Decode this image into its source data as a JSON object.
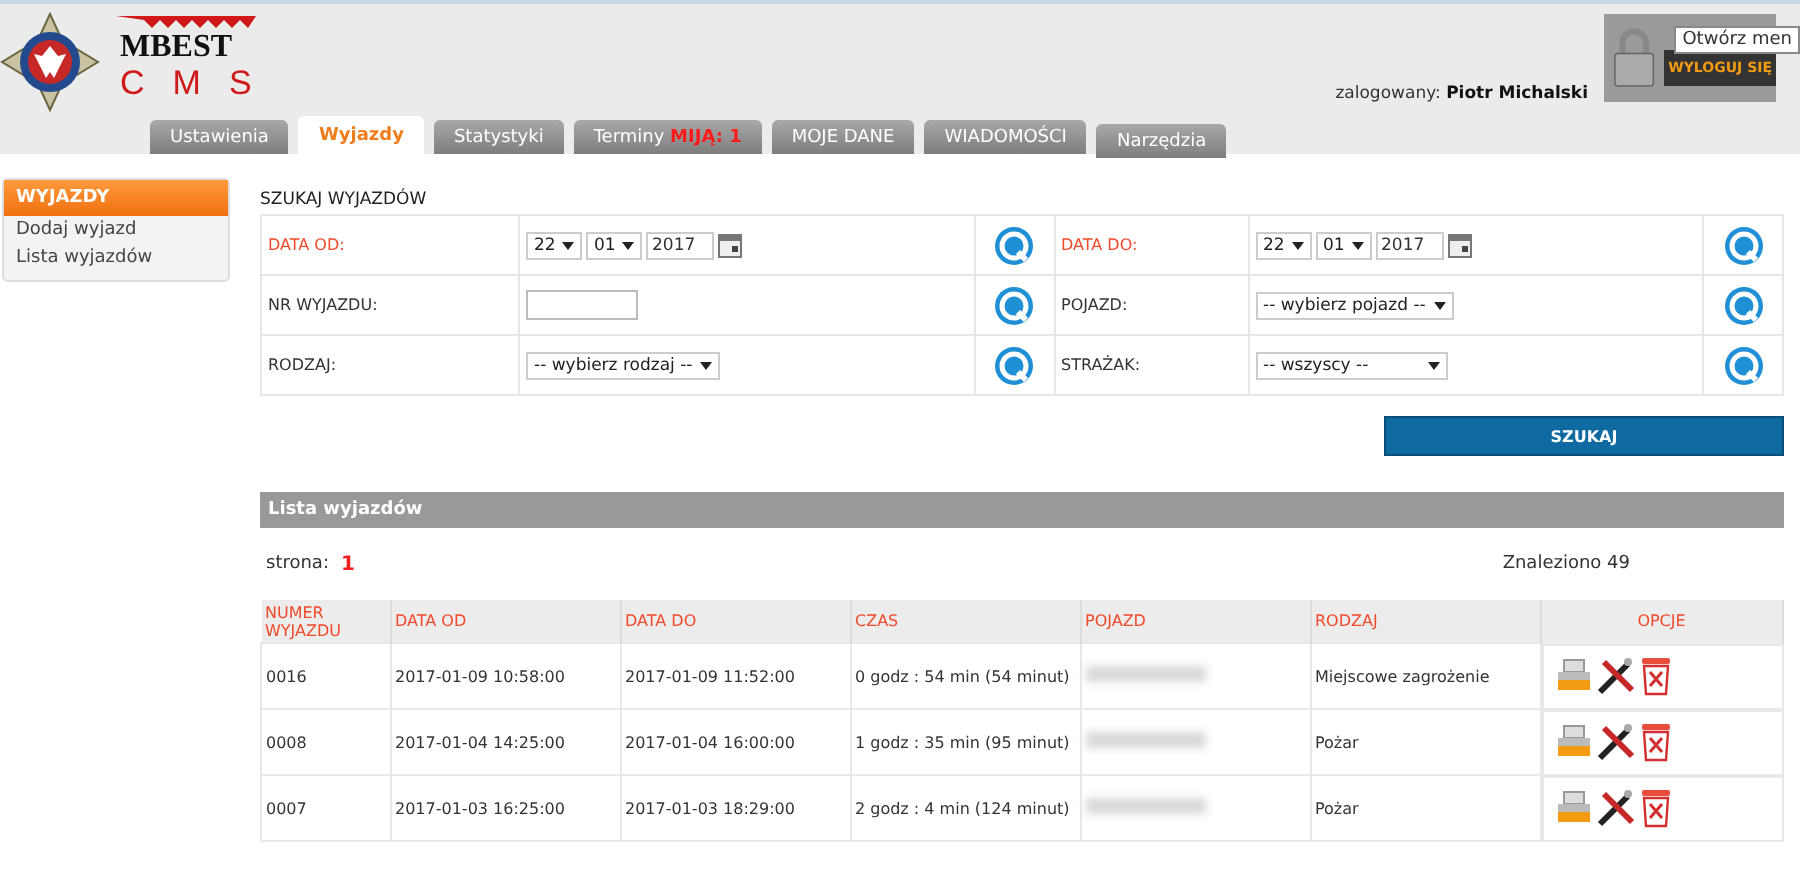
{
  "logo": {
    "top": "MBEST",
    "bottom": "CMS"
  },
  "tabs": [
    {
      "label": "Ustawienia",
      "selected": false
    },
    {
      "label": "Wyjazdy",
      "selected": true
    },
    {
      "label": "Statystyki",
      "selected": false
    },
    {
      "label": "Terminy",
      "badge": "MIJĄ: 1",
      "selected": false
    },
    {
      "label": "MOJE DANE",
      "selected": false
    },
    {
      "label": "WIADOMOŚCI",
      "selected": false
    },
    {
      "label": "Narzędzia",
      "selected": false
    }
  ],
  "user": {
    "label": "zalogowany:",
    "name": "Piotr Michalski"
  },
  "logout": {
    "label": "WYLOGUJ SIĘ",
    "tooltip": "Otwórz men"
  },
  "sidebar": {
    "title": "WYJAZDY",
    "items": [
      {
        "label": "Dodaj wyjazd"
      },
      {
        "label": "Lista wyjazdów"
      }
    ]
  },
  "search": {
    "title": "SZUKAJ WYJAZDÓW",
    "rows": [
      [
        {
          "label": "DATA OD:",
          "highlighted": true,
          "kind": "date",
          "day": "22",
          "month": "01",
          "year": "2017"
        },
        {
          "label": "DATA DO:",
          "highlighted": true,
          "kind": "date",
          "day": "22",
          "month": "01",
          "year": "2017"
        }
      ],
      [
        {
          "label": "NR WYJAZDU:",
          "highlighted": false,
          "kind": "text"
        },
        {
          "label": "POJAZD:",
          "highlighted": false,
          "kind": "select",
          "value": "-- wybierz pojazd --"
        }
      ],
      [
        {
          "label": "RODZAJ:",
          "highlighted": false,
          "kind": "select",
          "value": "-- wybierz rodzaj --"
        },
        {
          "label": "STRAŻAK:",
          "highlighted": false,
          "kind": "select",
          "value": "-- wszyscy --"
        }
      ]
    ],
    "button": "SZUKAJ"
  },
  "list": {
    "title": "Lista wyjazdów",
    "page_label": "strona:",
    "page": "1",
    "found": "Znaleziono 49",
    "columns": [
      "NUMER WYJAZDU",
      "DATA OD",
      "DATA DO",
      "CZAS",
      "POJAZD",
      "RODZAJ",
      "OPCJE"
    ],
    "rows": [
      {
        "number": "0016",
        "from": "2017-01-09 10:58:00",
        "to": "2017-01-09 11:52:00",
        "duration": "0 godz : 54 min (54 minut)",
        "type": "Miejscowe zagrożenie"
      },
      {
        "number": "0008",
        "from": "2017-01-04 14:25:00",
        "to": "2017-01-04 16:00:00",
        "duration": "1 godz : 35 min (95 minut)",
        "type": "Pożar"
      },
      {
        "number": "0007",
        "from": "2017-01-03 16:25:00",
        "to": "2017-01-03 18:29:00",
        "duration": "2 godz : 4 min (124 minut)",
        "type": "Pożar"
      }
    ]
  }
}
